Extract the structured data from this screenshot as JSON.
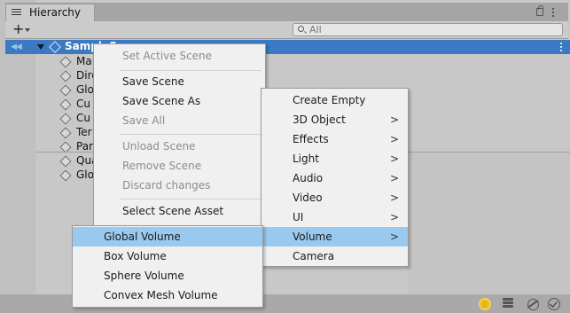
{
  "window": {
    "tab_title": "Hierarchy"
  },
  "toolbar": {
    "add_label": "+",
    "search_placeholder": "All"
  },
  "hierarchy": {
    "scene_name": "SampleS",
    "objects": [
      "Ma",
      "Dire",
      "Glo",
      "Cu",
      "Cu",
      "Ter",
      "Par",
      "Qua",
      "Glo"
    ]
  },
  "scene_menu": {
    "items": [
      {
        "label": "Set Active Scene",
        "enabled": false
      },
      {
        "label": "Save Scene",
        "enabled": true
      },
      {
        "label": "Save Scene As",
        "enabled": true
      },
      {
        "label": "Save All",
        "enabled": false
      },
      {
        "label": "Unload Scene",
        "enabled": false
      },
      {
        "label": "Remove Scene",
        "enabled": false
      },
      {
        "label": "Discard changes",
        "enabled": false
      },
      {
        "label": "Select Scene Asset",
        "enabled": true
      }
    ]
  },
  "create_menu": {
    "items": [
      {
        "label": "Create Empty",
        "submenu": false
      },
      {
        "label": "3D Object",
        "submenu": true
      },
      {
        "label": "Effects",
        "submenu": true
      },
      {
        "label": "Light",
        "submenu": true
      },
      {
        "label": "Audio",
        "submenu": true
      },
      {
        "label": "Video",
        "submenu": true
      },
      {
        "label": "UI",
        "submenu": true
      },
      {
        "label": "Volume",
        "submenu": true,
        "highlighted": true
      },
      {
        "label": "Camera",
        "submenu": false
      }
    ],
    "chevron": ">"
  },
  "volume_menu": {
    "items": [
      {
        "label": "Global Volume",
        "highlighted": true
      },
      {
        "label": "Box Volume"
      },
      {
        "label": "Sphere Volume"
      },
      {
        "label": "Convex Mesh Volume"
      }
    ]
  },
  "colors": {
    "selection": "#3b79c3",
    "menu_highlight": "#99c9ef",
    "menu_background": "#f0f0f0",
    "disabled_text": "#8c8c8c"
  },
  "icons": {
    "tab": "hierarchy-list-icon",
    "lock": "lock-icon",
    "menu": "kebab-menu-icon",
    "search": "search-icon",
    "scene": "unity-scene-icon",
    "object": "gameobject-cube-icon",
    "bottom": [
      "lighting-icon",
      "layers-icon",
      "scene-visibility-icon",
      "checkmark-icon"
    ]
  }
}
